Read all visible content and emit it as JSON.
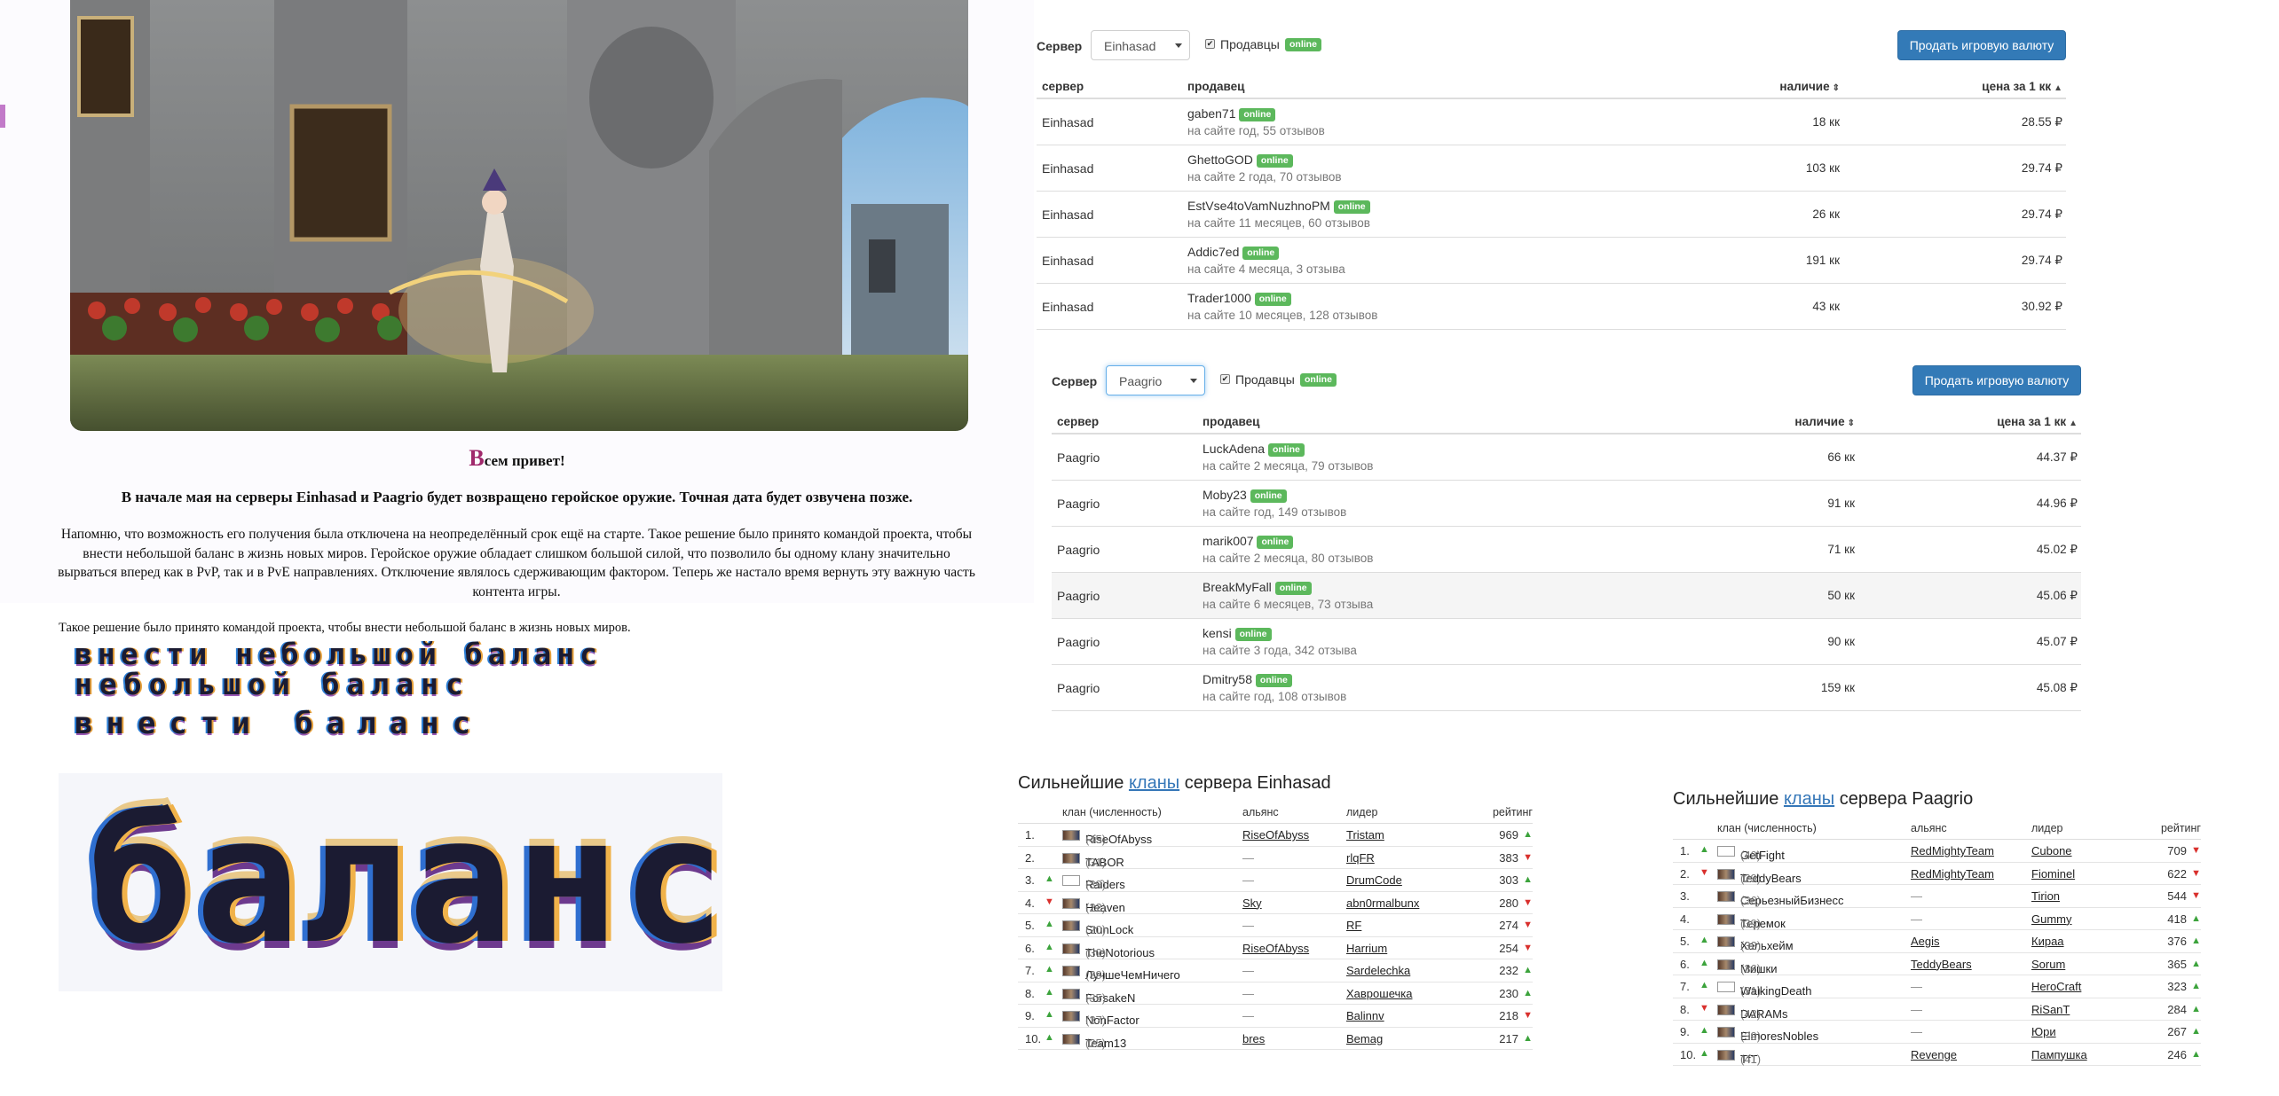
{
  "article": {
    "greeting_cap": "В",
    "greeting_rest": "сем привет!",
    "lead": "В начале мая на серверы Einhasad и Paagrio будет возвращено геройское оружие. Точная дата будет озвучена позже.",
    "body_lines": [
      "Напомню, что возможность его получения была отключена на неопределённый срок ещё на старте. Такое решение было принято командой проекта, чтобы",
      "внести небольшой баланс в жизнь новых миров. Геройское оружие обладает слишком большой силой, что позволило бы одному клану значительно",
      "вырваться вперед как в PvP, так и в PvE направлениях. Отключение являлось сдерживающим фактором. Теперь же настало время вернуть эту важную часть",
      "контента игры."
    ],
    "quote": "Такое решение было принято командой проекта, чтобы  внести небольшой баланс в жизнь новых миров.",
    "pixel_texts": [
      "внести небольшой баланс",
      "небольшой баланс",
      "внести баланс",
      "баланс"
    ]
  },
  "offers": [
    {
      "server_label": "Сервер",
      "server_value": "Einhasad",
      "sellers_label": "Продавцы",
      "online_badge": "online",
      "sell_button": "Продать игровую валюту",
      "columns": {
        "server": "сервер",
        "seller": "продавец",
        "qty": "наличие",
        "price": "цена за 1 кк"
      },
      "rows": [
        {
          "server": "Einhasad",
          "name": "gaben71",
          "badge": "online",
          "meta": "на сайте год, 55 отзывов",
          "qty": "18 кк",
          "price": "28.55 ₽"
        },
        {
          "server": "Einhasad",
          "name": "GhettoGOD",
          "badge": "online",
          "meta": "на сайте 2 года, 70 отзывов",
          "qty": "103 кк",
          "price": "29.74 ₽"
        },
        {
          "server": "Einhasad",
          "name": "EstVse4toVamNuzhnoPM",
          "badge": "online",
          "meta": "на сайте 11 месяцев, 60 отзывов",
          "qty": "26 кк",
          "price": "29.74 ₽"
        },
        {
          "server": "Einhasad",
          "name": "Addic7ed",
          "badge": "online",
          "meta": "на сайте 4 месяца, 3 отзыва",
          "qty": "191 кк",
          "price": "29.74 ₽"
        },
        {
          "server": "Einhasad",
          "name": "Trader1000",
          "badge": "online",
          "meta": "на сайте 10 месяцев, 128 отзывов",
          "qty": "43 кк",
          "price": "30.92 ₽"
        }
      ]
    },
    {
      "server_label": "Сервер",
      "server_value": "Paagrio",
      "sellers_label": "Продавцы",
      "online_badge": "online",
      "sell_button": "Продать игровую валюту",
      "columns": {
        "server": "сервер",
        "seller": "продавец",
        "qty": "наличие",
        "price": "цена за 1 кк"
      },
      "rows": [
        {
          "server": "Paagrio",
          "name": "LuckAdena",
          "badge": "online",
          "meta": "на сайте 2 месяца, 79 отзывов",
          "qty": "66 кк",
          "price": "44.37 ₽"
        },
        {
          "server": "Paagrio",
          "name": "Moby23",
          "badge": "online",
          "meta": "на сайте год, 149 отзывов",
          "qty": "91 кк",
          "price": "44.96 ₽"
        },
        {
          "server": "Paagrio",
          "name": "marik007",
          "badge": "online",
          "meta": "на сайте 2 месяца, 80 отзывов",
          "qty": "71 кк",
          "price": "45.02 ₽"
        },
        {
          "server": "Paagrio",
          "name": "BreakMyFall",
          "badge": "online",
          "meta": "на сайте 6 месяцев, 73 отзыва",
          "qty": "50 кк",
          "price": "45.06 ₽"
        },
        {
          "server": "Paagrio",
          "name": "kensi",
          "badge": "online",
          "meta": "на сайте 3 года, 342 отзыва",
          "qty": "90 кк",
          "price": "45.07 ₽"
        },
        {
          "server": "Paagrio",
          "name": "Dmitry58",
          "badge": "online",
          "meta": "на сайте год, 108 отзывов",
          "qty": "159 кк",
          "price": "45.08 ₽"
        }
      ]
    }
  ],
  "clans": [
    {
      "title_pre": "Сильнейшие ",
      "title_link": "кланы",
      "title_post": " сервера Einhasad",
      "columns": {
        "clan": "клан (численность)",
        "alliance": "альянс",
        "leader": "лидер",
        "rating": "рейтинг"
      },
      "rows": [
        {
          "rank": "1.",
          "trend": "",
          "flag": true,
          "name": "RiseOfAbyss",
          "count": "(45)",
          "alliance": "RiseOfAbyss",
          "leader": "Tristam",
          "score": "969",
          "dir": "up"
        },
        {
          "rank": "2.",
          "trend": "",
          "flag": true,
          "name": "TABOR",
          "count": "(31)",
          "alliance": "—",
          "leader": "rlqFR",
          "score": "383",
          "dir": "down"
        },
        {
          "rank": "3.",
          "trend": "up",
          "flag": false,
          "name": "Raiders",
          "count": "(39)",
          "alliance": "—",
          "leader": "DrumCode",
          "score": "303",
          "dir": "up"
        },
        {
          "rank": "4.",
          "trend": "down",
          "flag": true,
          "name": "Heaven",
          "count": "(22)",
          "alliance": "Sky",
          "leader": "abn0rmalbunx",
          "score": "280",
          "dir": "down"
        },
        {
          "rank": "5.",
          "trend": "up",
          "flag": true,
          "name": "StunLock",
          "count": "(20)",
          "alliance": "—",
          "leader": "RF",
          "score": "274",
          "dir": "down"
        },
        {
          "rank": "6.",
          "trend": "up",
          "flag": true,
          "name": "TheNotorious",
          "count": "(30)",
          "alliance": "RiseOfAbyss",
          "leader": "Harrium",
          "score": "254",
          "dir": "down"
        },
        {
          "rank": "7.",
          "trend": "up",
          "flag": true,
          "name": "ЛучшеЧемНичего",
          "count": "(39)",
          "alliance": "—",
          "leader": "Sardelechka",
          "score": "232",
          "dir": "up"
        },
        {
          "rank": "8.",
          "trend": "up",
          "flag": true,
          "name": "ForsakeN",
          "count": "(35)",
          "alliance": "—",
          "leader": "Хаврошечка",
          "score": "230",
          "dir": "up"
        },
        {
          "rank": "9.",
          "trend": "up",
          "flag": true,
          "name": "NonFactor",
          "count": "(37)",
          "alliance": "—",
          "leader": "Balinnv",
          "score": "218",
          "dir": "down"
        },
        {
          "rank": "10.",
          "trend": "up",
          "flag": true,
          "name": "Team13",
          "count": "(25)",
          "alliance": "bres",
          "leader": "Bemag",
          "score": "217",
          "dir": "up"
        }
      ]
    },
    {
      "title_pre": "Сильнейшие ",
      "title_link": "кланы",
      "title_post": " сервера Paagrio",
      "columns": {
        "clan": "клан (численность)",
        "alliance": "альянс",
        "leader": "лидер",
        "rating": "рейтинг"
      },
      "rows": [
        {
          "rank": "1.",
          "trend": "up",
          "flag": false,
          "name": "GetFight",
          "count": "(40)",
          "alliance": "RedMightyTeam",
          "leader": "Cubone",
          "score": "709",
          "dir": "down"
        },
        {
          "rank": "2.",
          "trend": "down",
          "flag": true,
          "name": "TeddyBears",
          "count": "(29)",
          "alliance": "RedMightyTeam",
          "leader": "Fiominel",
          "score": "622",
          "dir": "down"
        },
        {
          "rank": "3.",
          "trend": "",
          "flag": true,
          "name": "СерьезныйБизнесс",
          "count": "(36)",
          "alliance": "—",
          "leader": "Tirion",
          "score": "544",
          "dir": "down"
        },
        {
          "rank": "4.",
          "trend": "",
          "flag": true,
          "name": "Теремок",
          "count": "(39)",
          "alliance": "—",
          "leader": "Gummy",
          "score": "418",
          "dir": "up"
        },
        {
          "rank": "5.",
          "trend": "up",
          "flag": true,
          "name": "Хельхейм",
          "count": "(32)",
          "alliance": "Aegis",
          "leader": "Кираа",
          "score": "376",
          "dir": "up"
        },
        {
          "rank": "6.",
          "trend": "up",
          "flag": true,
          "name": "Мишки",
          "count": "(36)",
          "alliance": "TeddyBears",
          "leader": "Sorum",
          "score": "365",
          "dir": "up"
        },
        {
          "rank": "7.",
          "trend": "up",
          "flag": false,
          "name": "WalkingDeath",
          "count": "(31)",
          "alliance": "—",
          "leader": "HeroCraft",
          "score": "323",
          "dir": "up"
        },
        {
          "rank": "8.",
          "trend": "down",
          "flag": true,
          "name": "DARAMs",
          "count": "(42)",
          "alliance": "—",
          "leader": "RiSanT",
          "score": "284",
          "dir": "up"
        },
        {
          "rank": "9.",
          "trend": "up",
          "flag": true,
          "name": "ElmoresNobles",
          "count": "(39)",
          "alliance": "—",
          "leader": "Юри",
          "score": "267",
          "dir": "up"
        },
        {
          "rank": "10.",
          "trend": "up",
          "flag": true,
          "name": "TfT",
          "count": "(41)",
          "alliance": "Revenge",
          "leader": "Пампушка",
          "score": "246",
          "dir": "up"
        }
      ]
    }
  ],
  "colors": {
    "accent": "#337ab7",
    "online": "#5cb85c",
    "up": "#3ca33c",
    "down": "#d9302d",
    "greeting_cap": "#a0286b"
  }
}
